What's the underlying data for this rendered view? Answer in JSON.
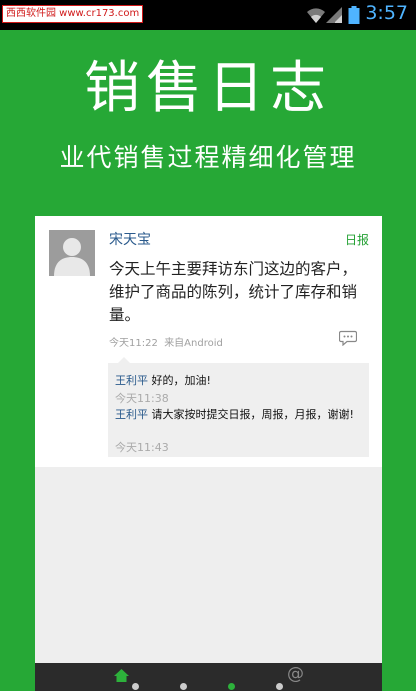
{
  "statusbar": {
    "watermark": "西西软件园 www.cr173.com",
    "time": "3:57",
    "icons": [
      "wifi-icon",
      "signal-icon",
      "battery-icon"
    ]
  },
  "hero": {
    "title": "销售日志",
    "subtitle": "业代销售过程精细化管理"
  },
  "post": {
    "author": "宋天宝",
    "tag": "日报",
    "body": "今天上午主要拜访东门这边的客户，维护了商品的陈列，统计了库存和销量。",
    "time": "今天11:22",
    "source": "来自Android",
    "comments": [
      {
        "name": "王利平",
        "text": "好的，加油!",
        "time": "今天11:38"
      },
      {
        "name": "王利平",
        "text": "请大家按时提交日报，周报，月报，谢谢!",
        "time": "今天11:43"
      }
    ]
  },
  "tabbar": {
    "tabs": [
      "home-icon",
      "tab-2",
      "tab-3",
      "tab-4",
      "at-icon"
    ],
    "active_index": 3
  },
  "colors": {
    "brand_green": "#26a836",
    "link_blue": "#2a5a8c",
    "clock_blue": "#4fb4ff"
  }
}
